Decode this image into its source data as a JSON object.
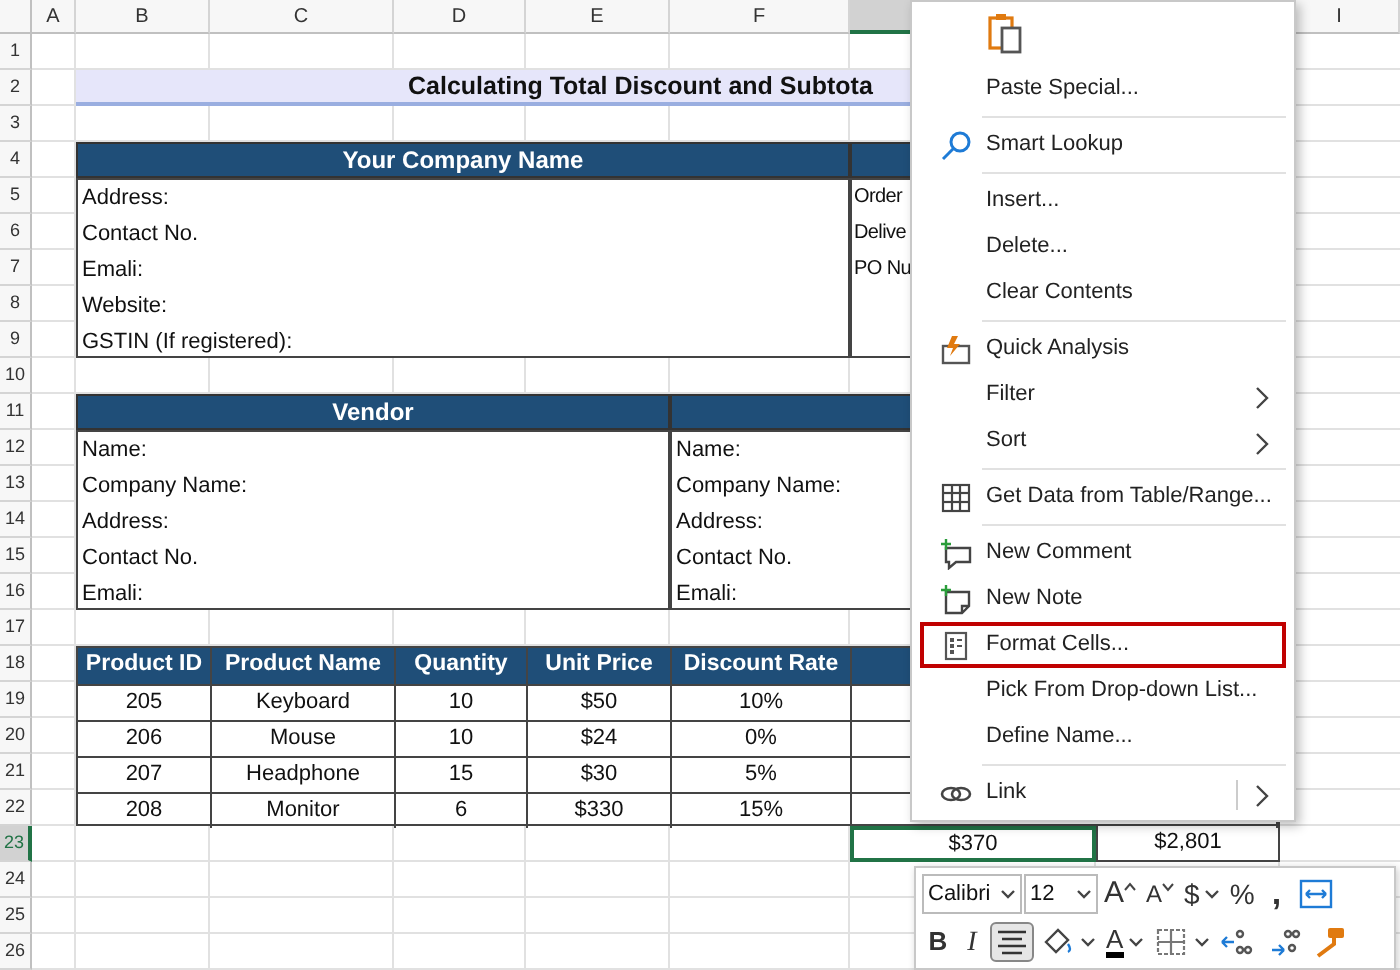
{
  "column_headers": [
    {
      "label": "A",
      "selected": false
    },
    {
      "label": "B",
      "selected": false
    },
    {
      "label": "C",
      "selected": false
    },
    {
      "label": "D",
      "selected": false
    },
    {
      "label": "E",
      "selected": false
    },
    {
      "label": "F",
      "selected": false
    },
    {
      "selected": true
    },
    {
      "label": "I",
      "selected": false
    }
  ],
  "row_headers": [
    {
      "label": "1",
      "selected": false
    },
    {
      "label": "2",
      "selected": false
    },
    {
      "label": "3",
      "selected": false
    },
    {
      "label": "4",
      "selected": false
    },
    {
      "label": "5",
      "selected": false
    },
    {
      "label": "6",
      "selected": false
    },
    {
      "label": "7",
      "selected": false
    },
    {
      "label": "8",
      "selected": false
    },
    {
      "label": "9",
      "selected": false
    },
    {
      "label": "10",
      "selected": false
    },
    {
      "label": "11",
      "selected": false
    },
    {
      "label": "12",
      "selected": false
    },
    {
      "label": "13",
      "selected": false
    },
    {
      "label": "14",
      "selected": false
    },
    {
      "label": "15",
      "selected": false
    },
    {
      "label": "16",
      "selected": false
    },
    {
      "label": "17",
      "selected": false
    },
    {
      "label": "18",
      "selected": false
    },
    {
      "label": "19",
      "selected": false
    },
    {
      "label": "20",
      "selected": false
    },
    {
      "label": "21",
      "selected": false
    },
    {
      "label": "22",
      "selected": false
    },
    {
      "label": "23",
      "selected": true
    },
    {
      "label": "24",
      "selected": false
    },
    {
      "label": "25",
      "selected": false
    },
    {
      "label": "26",
      "selected": false
    }
  ],
  "sheet": {
    "title": "Calculating Total Discount and Subtota",
    "company": {
      "header": "Your Company Name",
      "lines": [
        "Address:",
        "Contact No.",
        "Emali:",
        "Website:",
        "GSTIN (If registered):"
      ],
      "right_lines": [
        "Order",
        "Delive",
        "PO Nu"
      ]
    },
    "vendor": {
      "header": "Vendor",
      "lines": [
        "Name:",
        "Company Name:",
        "Address:",
        "Contact No.",
        "Emali:"
      ],
      "right_lines": [
        "Name:",
        "Company Name:",
        "Address:",
        "Contact No.",
        "Emali:"
      ]
    },
    "products": {
      "columns": [
        "Product ID",
        "Product Name",
        "Quantity",
        "Unit Price",
        "Discount Rate"
      ],
      "rows": [
        [
          "205",
          "Keyboard",
          "10",
          "$50",
          "10%"
        ],
        [
          "206",
          "Mouse",
          "10",
          "$24",
          "0%"
        ],
        [
          "207",
          "Headphone",
          "15",
          "$30",
          "5%"
        ],
        [
          "208",
          "Monitor",
          "6",
          "$330",
          "15%"
        ]
      ]
    },
    "totals": [
      {
        "value": "$370",
        "selected": true
      },
      {
        "value": "$2,801",
        "selected": false
      }
    ]
  },
  "context_menu": {
    "items": [
      {
        "kind": "paste-options"
      },
      {
        "kind": "plain",
        "label": "Paste Special...",
        "submenu": false,
        "split": false,
        "highlighted": false
      },
      {
        "kind": "separator"
      },
      {
        "kind": "lookup",
        "label": "Smart Lookup",
        "submenu": false,
        "split": false,
        "highlighted": false
      },
      {
        "kind": "separator"
      },
      {
        "kind": "plain",
        "label": "Insert...",
        "submenu": false,
        "split": false,
        "highlighted": false
      },
      {
        "kind": "plain",
        "label": "Delete...",
        "submenu": false,
        "split": false,
        "highlighted": false
      },
      {
        "kind": "plain",
        "label": "Clear Contents",
        "submenu": false,
        "split": false,
        "highlighted": false
      },
      {
        "kind": "separator"
      },
      {
        "kind": "analysis",
        "label": "Quick Analysis",
        "submenu": false,
        "split": false,
        "highlighted": false
      },
      {
        "kind": "plain",
        "label": "Filter",
        "submenu": true,
        "split": false,
        "highlighted": false
      },
      {
        "kind": "plain",
        "label": "Sort",
        "submenu": true,
        "split": false,
        "highlighted": false
      },
      {
        "kind": "separator"
      },
      {
        "kind": "table",
        "label": "Get Data from Table/Range...",
        "submenu": false,
        "split": false,
        "highlighted": false
      },
      {
        "kind": "separator"
      },
      {
        "kind": "comment",
        "label": "New Comment",
        "submenu": false,
        "split": false,
        "highlighted": false
      },
      {
        "kind": "note",
        "label": "New Note",
        "submenu": false,
        "split": false,
        "highlighted": false
      },
      {
        "kind": "format",
        "label": "Format Cells...",
        "submenu": false,
        "split": false,
        "highlighted": true
      },
      {
        "kind": "plain",
        "label": "Pick From Drop-down List...",
        "submenu": false,
        "split": false,
        "highlighted": false
      },
      {
        "kind": "plain",
        "label": "Define Name...",
        "submenu": false,
        "split": false,
        "highlighted": false
      },
      {
        "kind": "separator"
      },
      {
        "kind": "link",
        "label": "Link",
        "submenu": true,
        "split": true,
        "highlighted": false
      }
    ]
  },
  "mini_toolbar": {
    "rows": [
      {
        "items": [
          {
            "kind": "select",
            "value": "Calibri",
            "dropdown": true,
            "pressed": false
          },
          {
            "kind": "select",
            "value": "12",
            "dropdown": true,
            "pressed": false
          },
          {
            "kind": "grow",
            "label": "A",
            "dropdown": false,
            "pressed": false
          },
          {
            "kind": "shrink",
            "label": "A",
            "dropdown": false,
            "pressed": false
          },
          {
            "kind": "text",
            "label": "$",
            "dropdown": true,
            "pressed": false
          },
          {
            "kind": "text",
            "label": "%",
            "dropdown": false,
            "pressed": false
          },
          {
            "kind": "comma",
            "label": ",",
            "dropdown": false,
            "pressed": false
          },
          {
            "kind": "wrap",
            "dropdown": false,
            "pressed": false
          }
        ]
      },
      {
        "items": [
          {
            "kind": "bold",
            "label": "B",
            "dropdown": false,
            "pressed": false
          },
          {
            "kind": "italic",
            "label": "I",
            "dropdown": false,
            "pressed": false
          },
          {
            "kind": "align",
            "dropdown": false,
            "pressed": true
          },
          {
            "kind": "fill",
            "dropdown": true,
            "pressed": false
          },
          {
            "kind": "fontcolor",
            "label": "A",
            "dropdown": true,
            "pressed": false
          },
          {
            "kind": "borders",
            "dropdown": true,
            "pressed": false
          },
          {
            "kind": "incdec",
            "dropdown": false,
            "pressed": false
          },
          {
            "kind": "decdec",
            "dropdown": false,
            "pressed": false
          },
          {
            "kind": "painter",
            "dropdown": false,
            "pressed": false
          }
        ]
      }
    ]
  }
}
